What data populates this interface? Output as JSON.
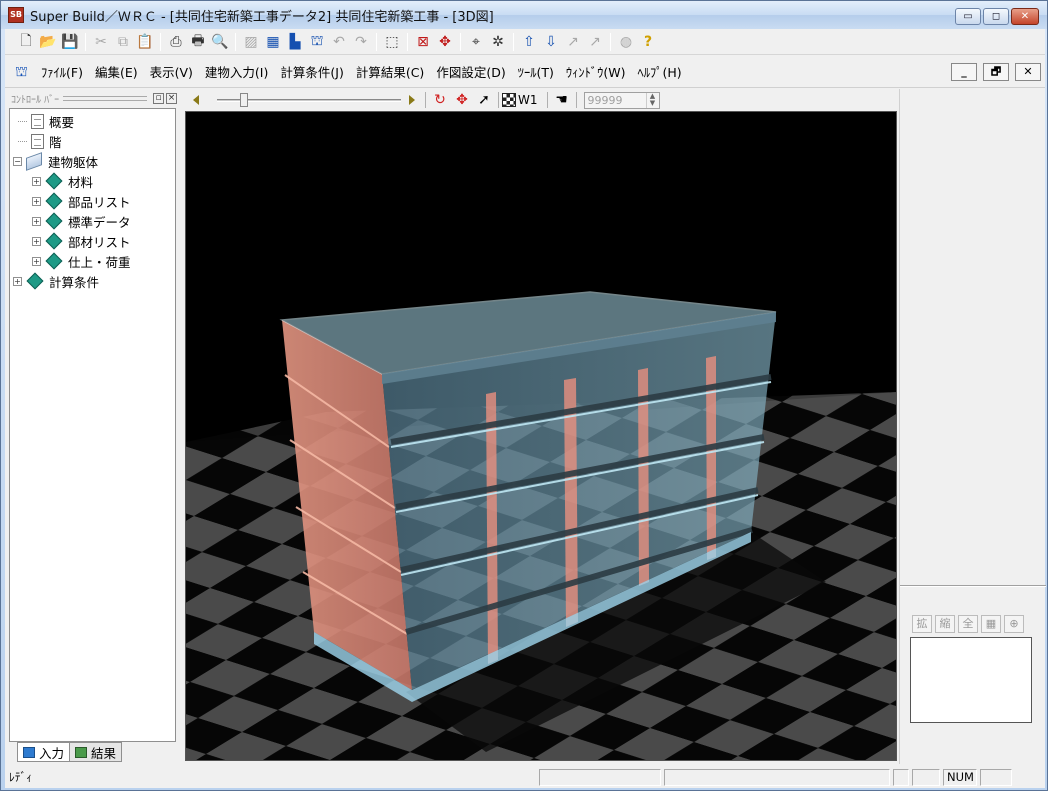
{
  "window": {
    "title": "Super Build／ＷＲＣ - [共同住宅新築工事データ2] 共同住宅新築工事 - [3D図]",
    "app_icon_label": "SB",
    "buttons": {
      "minimize": "▭",
      "maximize": "◻",
      "close": "✕"
    }
  },
  "toolbar": {
    "icons": [
      "new-file-icon",
      "open-folder-icon",
      "save-icon",
      "cut-icon",
      "copy-icon",
      "paste-icon",
      "print-setup-icon",
      "print-icon",
      "print-preview-icon",
      "image-icon",
      "grid-blue-icon",
      "grid-plan-icon",
      "building-icon",
      "undo-icon",
      "redo-icon",
      "select-region-icon",
      "stop-red-icon",
      "move-red-icon",
      "crosshair-icon",
      "snap-icon",
      "arrow-up-a-icon",
      "arrow-down-a-icon",
      "arrow-gray-1-icon",
      "arrow-gray-2-icon",
      "globe-icon",
      "help-icon"
    ]
  },
  "menubar": {
    "items": [
      "ﾌｧｲﾙ(F)",
      "編集(E)",
      "表示(V)",
      "建物入力(I)",
      "計算条件(J)",
      "計算結果(C)",
      "作図設定(D)",
      "ﾂｰﾙ(T)",
      "ｳｨﾝﾄﾞｳ(W)",
      "ﾍﾙﾌﾟ(H)"
    ],
    "mdi_buttons": {
      "minimize": "_",
      "restore": "🗗",
      "close": "✕"
    }
  },
  "control_panel": {
    "title": "ｺﾝﾄﾛｰﾙ ﾊﾞｰ",
    "tree": [
      {
        "label": "概要",
        "icon": "document-icon",
        "expander": "",
        "level": 1
      },
      {
        "label": "階",
        "icon": "document-icon",
        "expander": "",
        "level": 1
      },
      {
        "label": "建物躯体",
        "icon": "book-icon",
        "expander": "−",
        "level": 0
      },
      {
        "label": "材料",
        "icon": "diamond-icon",
        "expander": "+",
        "level": 1
      },
      {
        "label": "部品リスト",
        "icon": "diamond-icon",
        "expander": "+",
        "level": 1
      },
      {
        "label": "標準データ",
        "icon": "diamond-icon",
        "expander": "+",
        "level": 1
      },
      {
        "label": "部材リスト",
        "icon": "diamond-icon",
        "expander": "+",
        "level": 1
      },
      {
        "label": "仕上・荷重",
        "icon": "diamond-icon",
        "expander": "+",
        "level": 1
      },
      {
        "label": "計算条件",
        "icon": "diamond-icon",
        "expander": "+",
        "level": 0
      }
    ],
    "tabs": [
      "入力",
      "結果"
    ]
  },
  "view_toolbar": {
    "slider_value": 0.13,
    "layer_label": "W1",
    "spin_value": "99999"
  },
  "right_pane": {
    "mini_tools": [
      "拡",
      "縮",
      "全",
      "▦",
      "⊕"
    ]
  },
  "statusbar": {
    "message": "ﾚﾃﾞｨ",
    "num": "NUM"
  },
  "colors": {
    "viewport_bg": "#000000",
    "glass_blue": "#9fd6ee",
    "wall_pink": "#f2a08a",
    "floor_gray": "#3a3a3a"
  }
}
